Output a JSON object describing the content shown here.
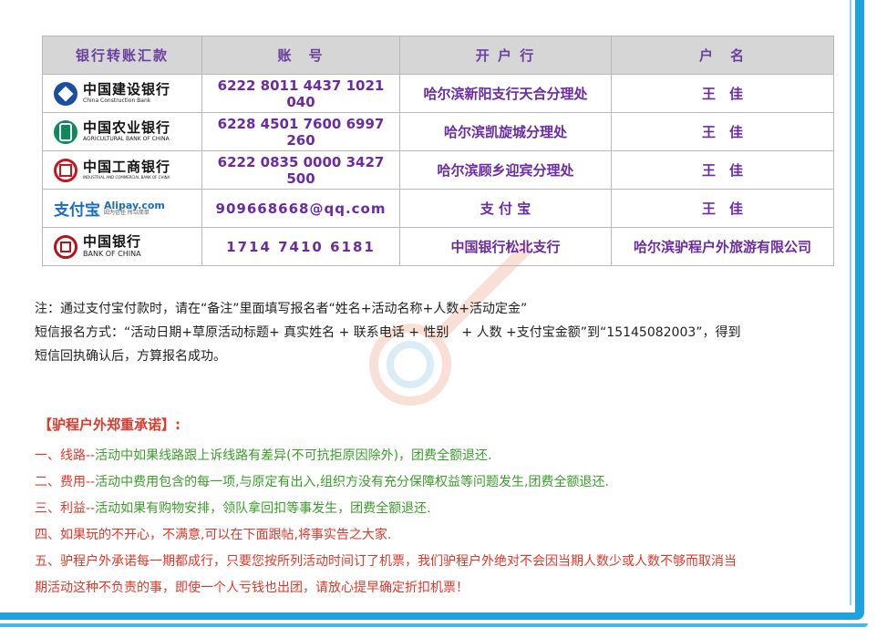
{
  "table": {
    "headers": [
      "银行转账汇款",
      "账　号",
      "开 户 行",
      "户　名"
    ],
    "rows": [
      {
        "bank_cn": "中国建设银行",
        "bank_en": "China Construction Bank",
        "account": "6222 8011 4437 1021 040",
        "branch": "哈尔滨新阳支行天合分理处",
        "holder": "王　佳",
        "logo_color": "#1a4fa0"
      },
      {
        "bank_cn": "中国农业银行",
        "bank_en": "AGRICULTURAL BANK OF CHINA",
        "account": "6228 4501 7600 6997 260",
        "branch": "哈尔滨凯旋城分理处",
        "holder": "王　佳",
        "logo_color": "#0e8a5a"
      },
      {
        "bank_cn": "中国工商银行",
        "bank_en": "INDUSTRIAL AND COMMERCIAL BANK OF CHINA",
        "account": "6222 0835 0000 3427 500",
        "branch": "哈尔滨顾乡迎宾分理处",
        "holder": "王　佳",
        "logo_color": "#c8161d"
      },
      {
        "bank_cn": "支付宝",
        "bank_en": "Alipay.com",
        "bank_sub": "因为信任 所以简单",
        "account": "909668668@qq.com",
        "branch": "支 付 宝",
        "holder": "王　佳",
        "logo_color": "#1a6fb8"
      },
      {
        "bank_cn": "中国银行",
        "bank_en": "BANK OF CHINA",
        "account": "1714  7410  6181",
        "branch": "中国银行松北支行",
        "holder": "哈尔滨驴程户外旅游有限公司",
        "logo_color": "#b5121b"
      }
    ]
  },
  "notes": [
    "注：通过支付宝付款时，请在“备注”里面填写报名者“姓名+活动名称+人数+活动定金”",
    "短信报名方式：“活动日期+草原活动标题+ 真实姓名 + 联系电话 + 性别　+ 人数 +支付宝金额”到“15145082003”，得到",
    "短信回执确认后，方算报名成功。"
  ],
  "promise_title": "【驴程户外郑重承诺】:",
  "promises": [
    {
      "num": "一、",
      "head": "线路--",
      "body": "活动中如果线路跟上诉线路有差异(不可抗拒原因除外)，团费全额退还."
    },
    {
      "num": "二、",
      "head": "费用--",
      "body": "活动中费用包含的每一项,与原定有出入,组织方没有充分保障权益等问题发生,团费全额退还."
    },
    {
      "num": "三、",
      "head": "利益--",
      "body": "活动如果有购物安排，领队拿回扣等事发生，团费全额退还."
    },
    {
      "num": "四、",
      "head": "",
      "body": "如果玩的不开心，不满意,可以在下面跟帖,将事实告之大家."
    },
    {
      "num": "五、",
      "head": "",
      "body": "驴程户外承诺每一期都成行，只要您按所列活动时间订了机票，我们驴程户外绝对不会因当期人数少或人数不够而取消当"
    },
    {
      "num": "",
      "head": "",
      "body": "期活动这种不负责的事，即使一个人亏钱也出团，请放心提早确定折扣机票！"
    }
  ],
  "colors": {
    "accent_blue": "#1fa3df",
    "text_purple": "#6b2ba5",
    "promise_red": "#e0382a",
    "promise_green": "#3a9d2a"
  }
}
